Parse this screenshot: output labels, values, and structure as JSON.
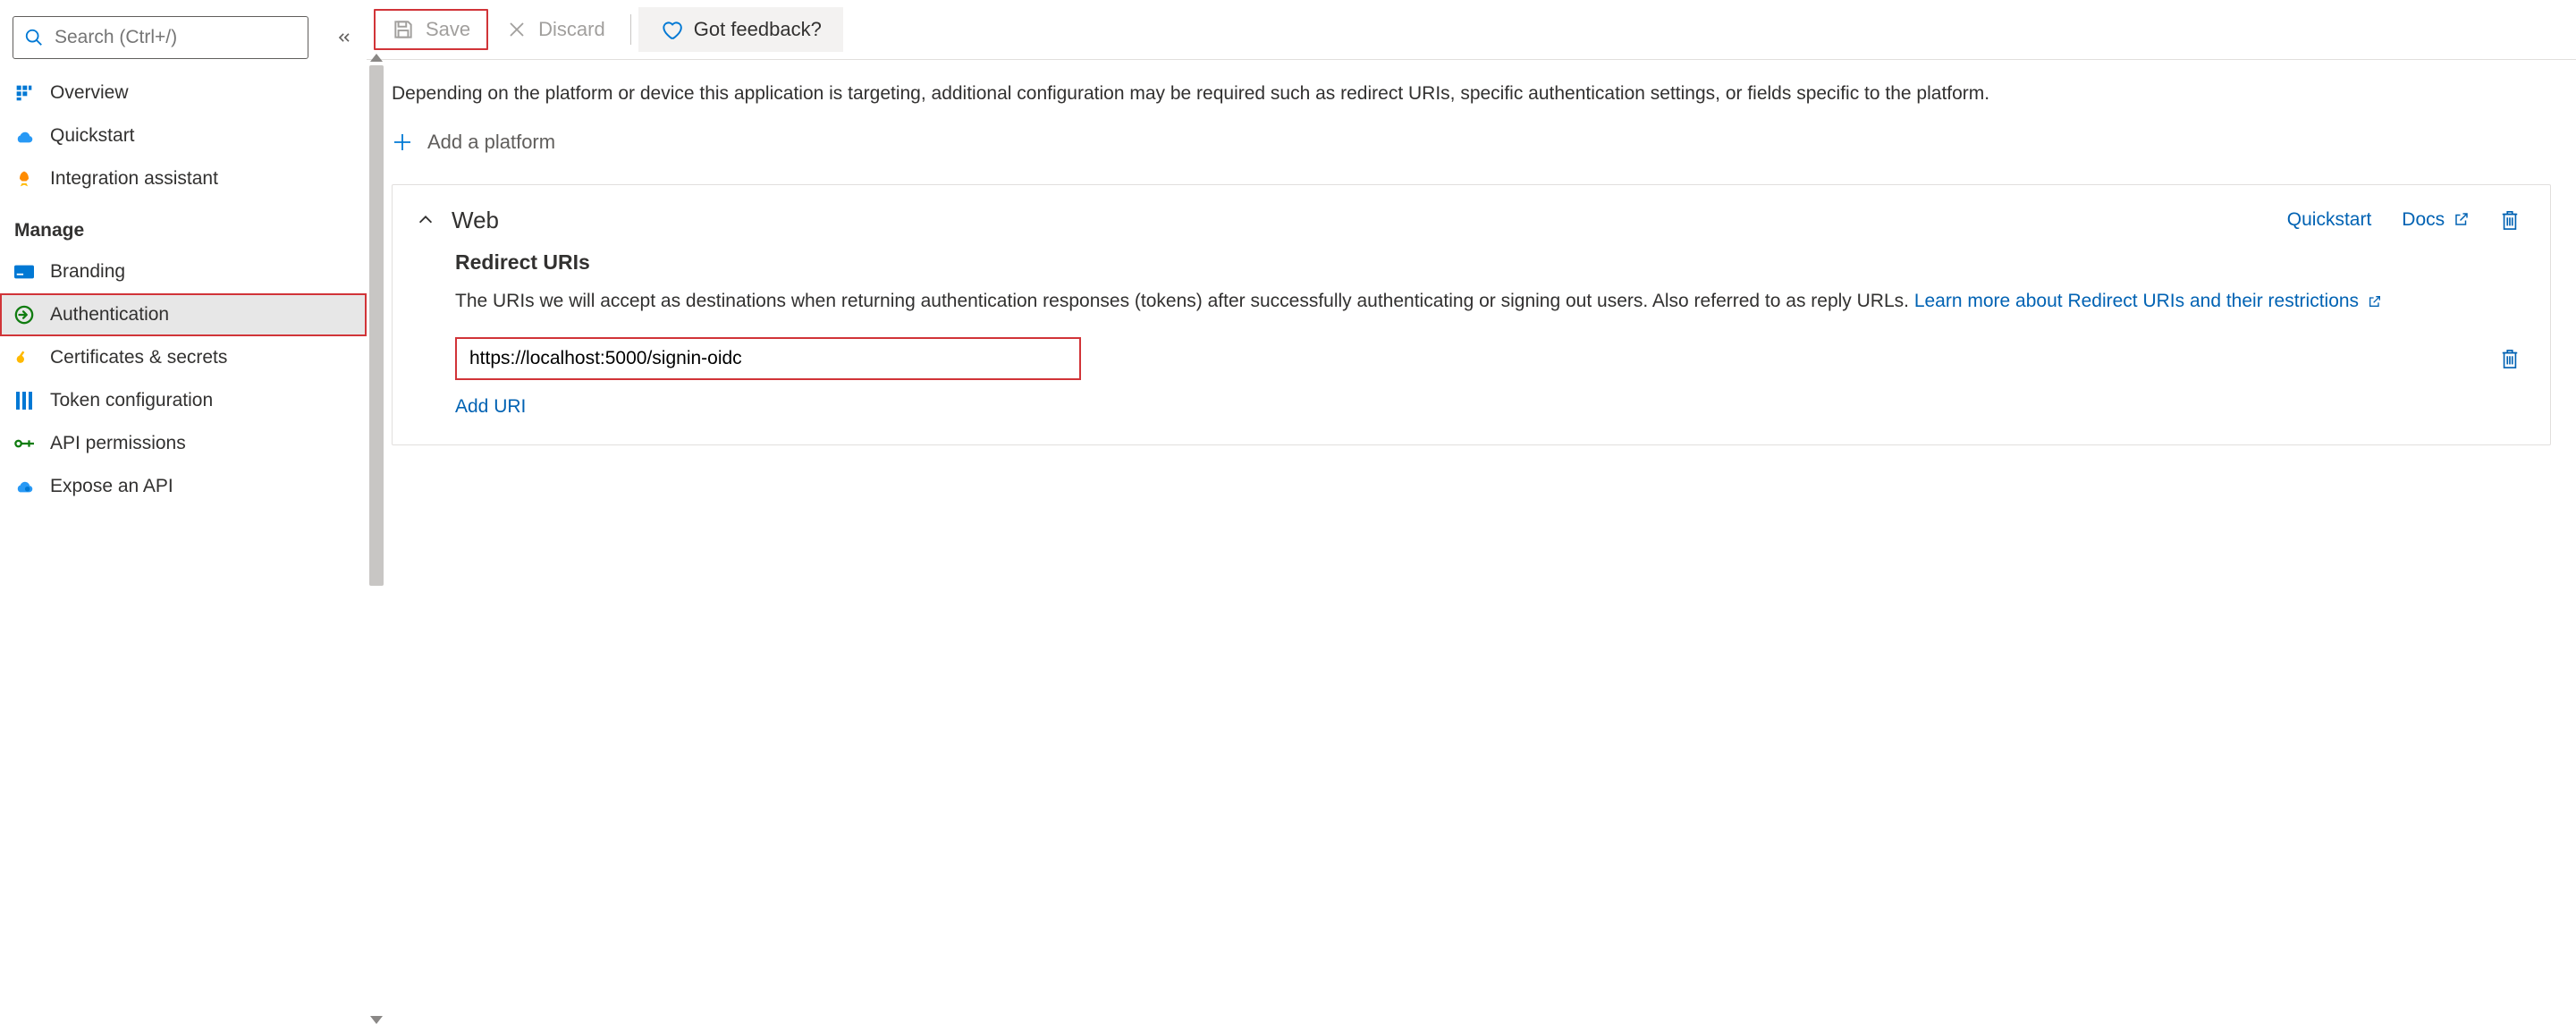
{
  "sidebar": {
    "search_placeholder": "Search (Ctrl+/)",
    "items": [
      {
        "label": "Overview"
      },
      {
        "label": "Quickstart"
      },
      {
        "label": "Integration assistant"
      }
    ],
    "manage_header": "Manage",
    "manage_items": [
      {
        "label": "Branding"
      },
      {
        "label": "Authentication"
      },
      {
        "label": "Certificates & secrets"
      },
      {
        "label": "Token configuration"
      },
      {
        "label": "API permissions"
      },
      {
        "label": "Expose an API"
      }
    ]
  },
  "toolbar": {
    "save_label": "Save",
    "discard_label": "Discard",
    "feedback_label": "Got feedback?"
  },
  "intro_text": "Depending on the platform or device this application is targeting, additional configuration may be required such as redirect URIs, specific authentication settings, or fields specific to the platform.",
  "add_platform_label": "Add a platform",
  "web_card": {
    "title": "Web",
    "quickstart_label": "Quickstart",
    "docs_label": "Docs",
    "redirect_heading": "Redirect URIs",
    "redirect_desc": "The URIs we will accept as destinations when returning authentication responses (tokens) after successfully authenticating or signing out users. Also referred to as reply URLs. ",
    "learn_more_label": "Learn more about Redirect URIs and their restrictions",
    "uri_value": "https://localhost:5000/signin-oidc",
    "add_uri_label": "Add URI"
  }
}
